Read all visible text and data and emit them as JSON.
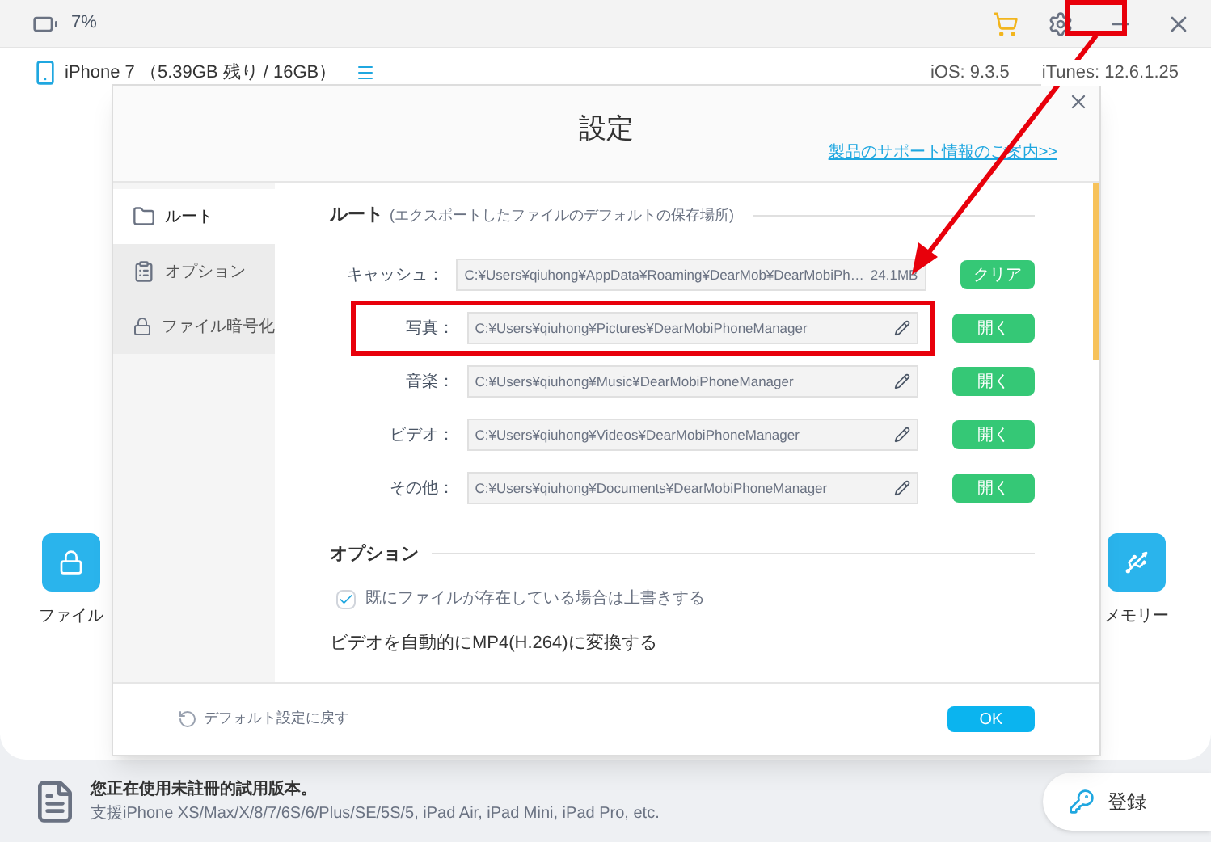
{
  "top_bar": {
    "battery": "7%"
  },
  "device_bar": {
    "device": "iPhone 7 （5.39GB 残り / 16GB）",
    "ios": "iOS: 9.3.5",
    "itunes": "iTunes: 12.6.1.25"
  },
  "background_tiles": [
    {
      "label": "ファイル"
    },
    {
      "label": "メモリー"
    }
  ],
  "dialog": {
    "title": "設定",
    "support_link": "製品のサポート情報のご案内>>",
    "sidebar": [
      {
        "label": "ルート",
        "selected": true
      },
      {
        "label": "オプション",
        "selected": false
      },
      {
        "label": "ファイル暗号化",
        "selected": false
      }
    ],
    "path_section": {
      "heading": "ルート",
      "note": "(エクスポートしたファイルのデフォルトの保存場所)",
      "rows": [
        {
          "label": "キャッシュ：",
          "path": "C:¥Users¥qiuhong¥AppData¥Roaming¥DearMob¥DearMobiPh…",
          "size": "24.1MB",
          "button": "クリア",
          "kind": "cache",
          "highlighted": false
        },
        {
          "label": "写真：",
          "path": "C:¥Users¥qiuhong¥Pictures¥DearMobiPhoneManager",
          "button": "開く",
          "kind": "folder",
          "highlighted": true
        },
        {
          "label": "音楽：",
          "path": "C:¥Users¥qiuhong¥Music¥DearMobiPhoneManager",
          "button": "開く",
          "kind": "folder",
          "highlighted": false
        },
        {
          "label": "ビデオ：",
          "path": "C:¥Users¥qiuhong¥Videos¥DearMobiPhoneManager",
          "button": "開く",
          "kind": "folder",
          "highlighted": false
        },
        {
          "label": "その他：",
          "path": "C:¥Users¥qiuhong¥Documents¥DearMobiPhoneManager",
          "button": "開く",
          "kind": "folder",
          "highlighted": false
        }
      ]
    },
    "options_section": {
      "heading": "オプション",
      "overwrite": {
        "label": "既にファイルが存在している場合は上書きする",
        "checked": true
      },
      "convert_label": "ビデオを自動的にMP4(H.264)に変換する"
    },
    "reset": "デフォルト設定に戻す",
    "ok": "OK"
  },
  "status": {
    "title": "您正在使用未註冊的試用版本。",
    "support": "支援iPhone XS/Max/X/8/7/6S/6/Plus/SE/5S/5, iPad Air, iPad Mini, iPad Pro, etc.",
    "register": "登録"
  }
}
